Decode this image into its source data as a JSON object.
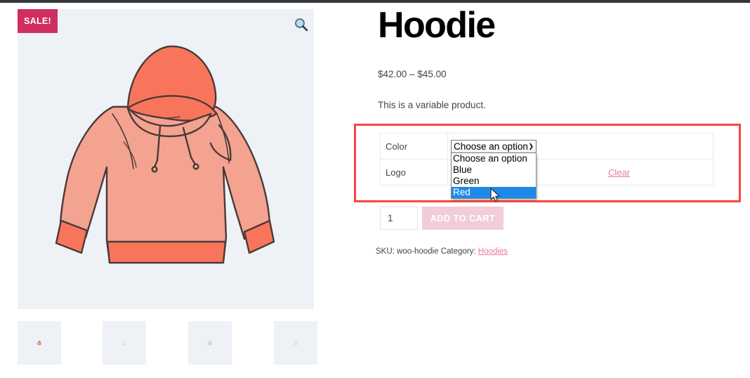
{
  "page": {
    "admin_bar_color": "#32373c",
    "background": "#ffffff"
  },
  "gallery": {
    "sale_badge": "SALE!",
    "sale_badge_color": "#cf2e5f",
    "zoom_icon": "magnifier-icon",
    "image_background": "#eef1f5",
    "main_image_alt": "Salmon colored hoodie illustration",
    "thumbnails": [
      {
        "name": "hoodie-red-thumb",
        "color": "#f4a08c",
        "accent": "#f4715a"
      },
      {
        "name": "hoodie-blue-thumb",
        "color": "#e3ecf0",
        "accent": "#cfdde4"
      },
      {
        "name": "hoodie-green-thumb",
        "color": "#bfe5cf",
        "accent": "#a3d9ba"
      },
      {
        "name": "hoodie-logo-thumb",
        "color": "#e9eff2",
        "accent": "#e8c56a"
      }
    ]
  },
  "summary": {
    "title": "Hoodie",
    "price": "$42.00 – $45.00",
    "short_description": "This is a variable product."
  },
  "variations": {
    "rows": [
      {
        "label": "Color",
        "type": "select"
      },
      {
        "label": "Logo",
        "type": "select"
      }
    ],
    "color_select": {
      "value": "Choose an option",
      "caret": "chevron-down-icon",
      "expanded": true,
      "options": [
        {
          "label": "Choose an option",
          "selected": false
        },
        {
          "label": "Blue",
          "selected": false
        },
        {
          "label": "Green",
          "selected": false
        },
        {
          "label": "Red",
          "selected": true
        }
      ],
      "highlight_color": "#1e8ae8"
    },
    "clear_label": "Clear",
    "clear_color": "#e8799b"
  },
  "cart": {
    "quantity": "1",
    "add_to_cart_label": "ADD TO CART",
    "add_to_cart_color": "#f3ccd9",
    "add_to_cart_disabled": true
  },
  "meta": {
    "sku_prefix": "SKU:",
    "sku_value": "woo-hoodie",
    "category_prefix": "Category:",
    "category_value": "Hoodies"
  },
  "annotation": {
    "box_color": "#f9473f",
    "shape": "rectangle-highlight"
  },
  "cursor": {
    "type": "arrow-pointer"
  }
}
